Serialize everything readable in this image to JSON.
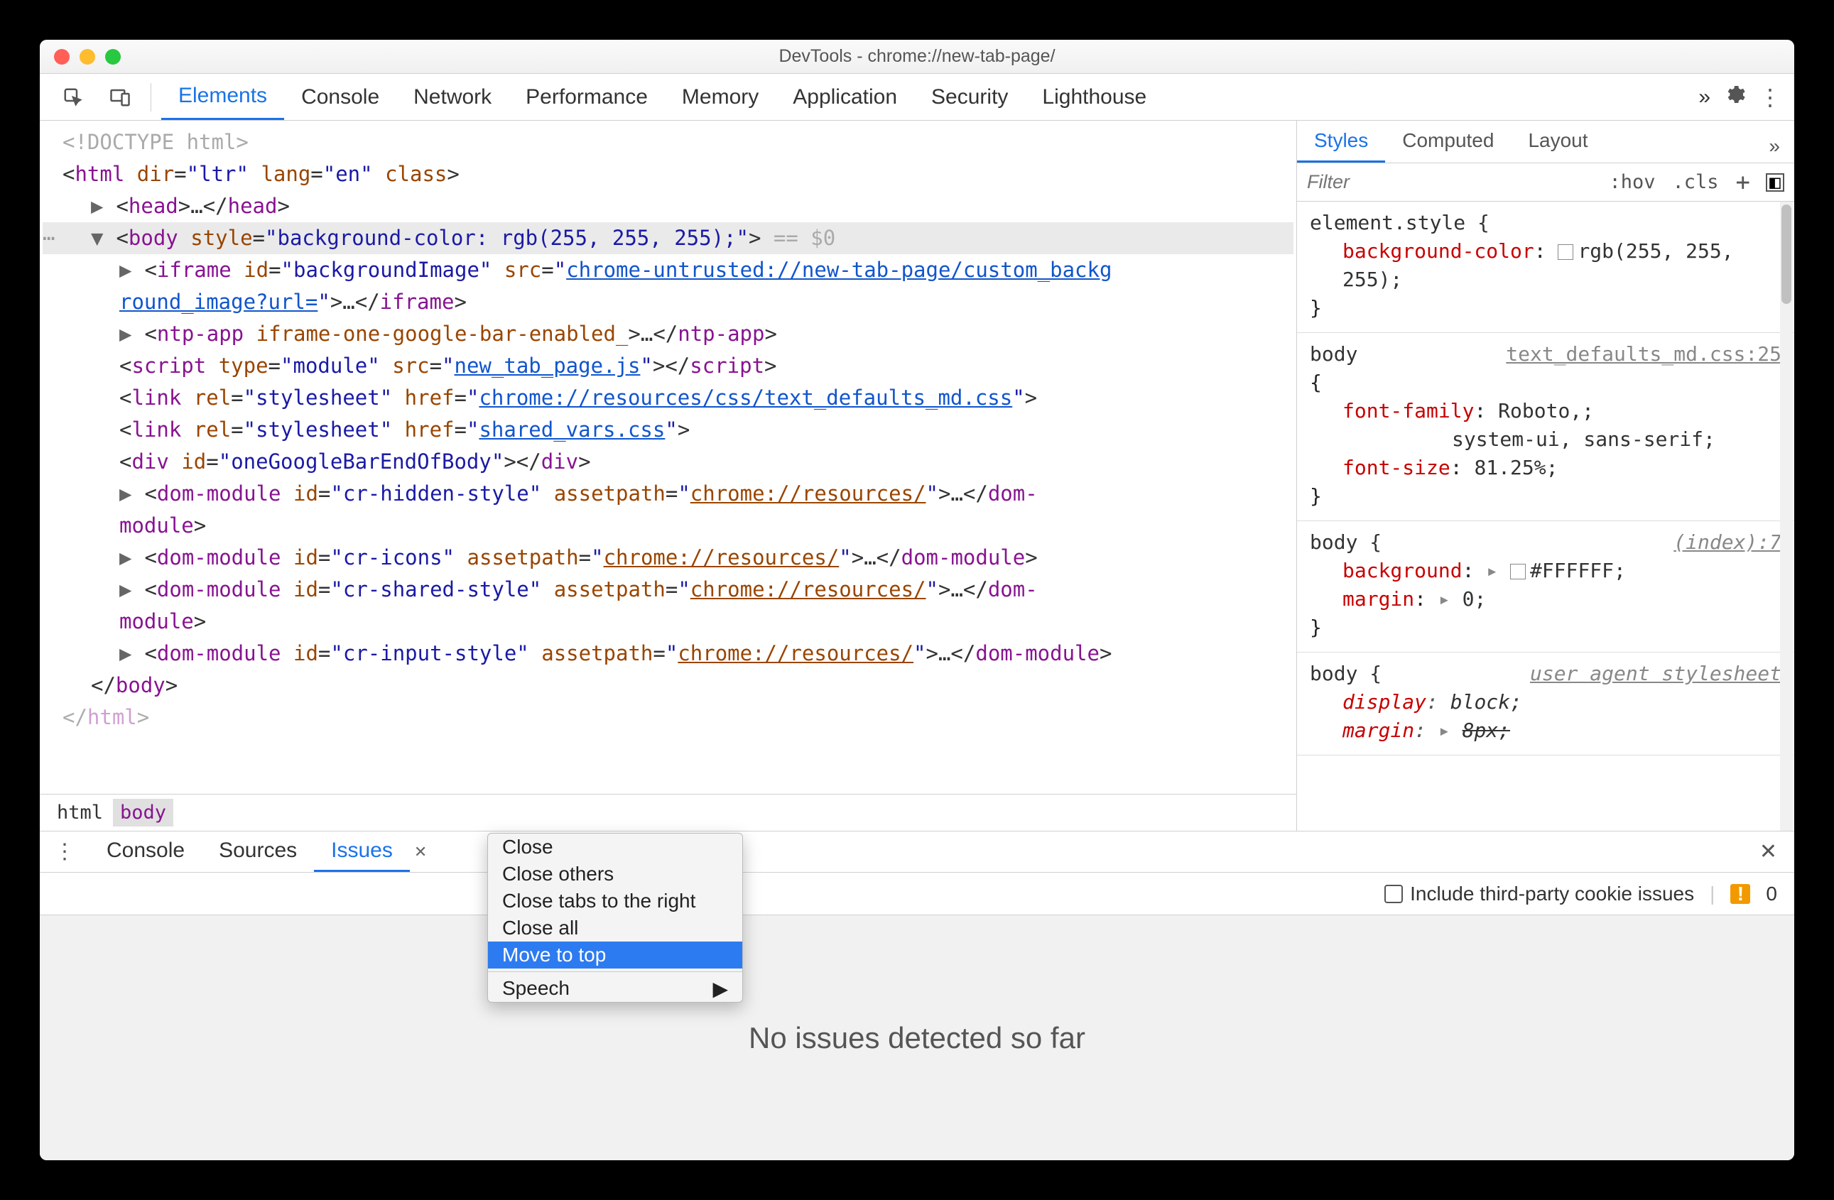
{
  "window": {
    "title": "DevTools - chrome://new-tab-page/"
  },
  "toolbar": {
    "tabs": [
      "Elements",
      "Console",
      "Network",
      "Performance",
      "Memory",
      "Application",
      "Security",
      "Lighthouse"
    ],
    "active": 0,
    "more_glyph": "»"
  },
  "dom": {
    "lines": [
      {
        "indent": 0,
        "html": "<span class='t-gray'>&lt;!DOCTYPE html&gt;</span>"
      },
      {
        "indent": 0,
        "html": "&lt;<span class='t-tag'>html</span> <span class='t-attr'>dir</span>=<span class='t-eq'>\"</span><span class='t-val'>ltr</span><span class='t-eq'>\"</span> <span class='t-attr'>lang</span>=<span class='t-eq'>\"</span><span class='t-val'>en</span><span class='t-eq'>\"</span> <span class='t-attr'>class</span>&gt;"
      },
      {
        "indent": 1,
        "arrow": "▶",
        "html": "&lt;<span class='t-tag'>head</span>&gt;…&lt;/<span class='t-tag'>head</span>&gt;"
      },
      {
        "indent": 1,
        "arrow": "▼",
        "sel": true,
        "dots": "⋯",
        "html": "&lt;<span class='t-tag'>body</span> <span class='t-attr'>style</span>=<span class='t-eq'>\"</span><span class='t-val'>background-color: rgb(255, 255, 255);</span><span class='t-eq'>\"</span>&gt;<span class='t-gray'> == $0</span>"
      },
      {
        "indent": 2,
        "arrow": "▶",
        "html": "&lt;<span class='t-tag'>iframe</span> <span class='t-attr'>id</span>=<span class='t-eq'>\"</span><span class='t-val'>backgroundImage</span><span class='t-eq'>\"</span> <span class='t-attr'>src</span>=<span class='t-eq'>\"</span><span class='t-link'>chrome-untrusted://new-tab-page/custom_backg</span>"
      },
      {
        "indent": 2,
        "cont": true,
        "html": "<span class='t-link'>round_image?url=</span><span class='t-eq'>\"</span>&gt;…&lt;/<span class='t-tag'>iframe</span>&gt;"
      },
      {
        "indent": 2,
        "arrow": "▶",
        "html": "&lt;<span class='t-tag'>ntp-app</span> <span class='t-attr'>iframe-one-google-bar-enabled_</span>&gt;…&lt;/<span class='t-tag'>ntp-app</span>&gt;"
      },
      {
        "indent": 2,
        "html": "&lt;<span class='t-tag'>script</span> <span class='t-attr'>type</span>=<span class='t-eq'>\"</span><span class='t-val'>module</span><span class='t-eq'>\"</span> <span class='t-attr'>src</span>=<span class='t-eq'>\"</span><span class='t-link'>new_tab_page.js</span><span class='t-eq'>\"</span>&gt;&lt;/<span class='t-tag'>script</span>&gt;"
      },
      {
        "indent": 2,
        "html": "&lt;<span class='t-tag'>link</span> <span class='t-attr'>rel</span>=<span class='t-eq'>\"</span><span class='t-val'>stylesheet</span><span class='t-eq'>\"</span> <span class='t-attr'>href</span>=<span class='t-eq'>\"</span><span class='t-link'>chrome://resources/css/text_defaults_md.css</span><span class='t-eq'>\"</span>&gt;"
      },
      {
        "indent": 2,
        "html": "&lt;<span class='t-tag'>link</span> <span class='t-attr'>rel</span>=<span class='t-eq'>\"</span><span class='t-val'>stylesheet</span><span class='t-eq'>\"</span> <span class='t-attr'>href</span>=<span class='t-eq'>\"</span><span class='t-link'>shared_vars.css</span><span class='t-eq'>\"</span>&gt;"
      },
      {
        "indent": 2,
        "html": "&lt;<span class='t-tag'>div</span> <span class='t-attr'>id</span>=<span class='t-eq'>\"</span><span class='t-val'>oneGoogleBarEndOfBody</span><span class='t-eq'>\"</span>&gt;&lt;/<span class='t-tag'>div</span>&gt;"
      },
      {
        "indent": 2,
        "arrow": "▶",
        "html": "&lt;<span class='t-tag'>dom-module</span> <span class='t-attr'>id</span>=<span class='t-eq'>\"</span><span class='t-val'>cr-hidden-style</span><span class='t-eq'>\"</span> <span class='t-attr'>assetpath</span>=<span class='t-eq'>\"</span><span class='t-url-attr'>chrome://resources/</span><span class='t-eq'>\"</span>&gt;…&lt;/<span class='t-tag'>dom-</span>"
      },
      {
        "indent": 2,
        "cont": true,
        "html": "<span class='t-tag'>module</span>&gt;"
      },
      {
        "indent": 2,
        "arrow": "▶",
        "html": "&lt;<span class='t-tag'>dom-module</span> <span class='t-attr'>id</span>=<span class='t-eq'>\"</span><span class='t-val'>cr-icons</span><span class='t-eq'>\"</span> <span class='t-attr'>assetpath</span>=<span class='t-eq'>\"</span><span class='t-url-attr'>chrome://resources/</span><span class='t-eq'>\"</span>&gt;…&lt;/<span class='t-tag'>dom-module</span>&gt;"
      },
      {
        "indent": 2,
        "arrow": "▶",
        "html": "&lt;<span class='t-tag'>dom-module</span> <span class='t-attr'>id</span>=<span class='t-eq'>\"</span><span class='t-val'>cr-shared-style</span><span class='t-eq'>\"</span> <span class='t-attr'>assetpath</span>=<span class='t-eq'>\"</span><span class='t-url-attr'>chrome://resources/</span><span class='t-eq'>\"</span>&gt;…&lt;/<span class='t-tag'>dom-</span>"
      },
      {
        "indent": 2,
        "cont": true,
        "html": "<span class='t-tag'>module</span>&gt;"
      },
      {
        "indent": 2,
        "arrow": "▶",
        "html": "&lt;<span class='t-tag'>dom-module</span> <span class='t-attr'>id</span>=<span class='t-eq'>\"</span><span class='t-val'>cr-input-style</span><span class='t-eq'>\"</span> <span class='t-attr'>assetpath</span>=<span class='t-eq'>\"</span><span class='t-url-attr'>chrome://resources/</span><span class='t-eq'>\"</span>&gt;…&lt;/<span class='t-tag'>dom-module</span>&gt;"
      },
      {
        "indent": 1,
        "html": "&lt;/<span class='t-tag'>body</span>&gt;"
      },
      {
        "indent": 0,
        "html": "&lt;/<span class='t-tag'>html</span>&gt;",
        "faded": true
      }
    ]
  },
  "breadcrumb": [
    "html",
    "body"
  ],
  "styles": {
    "tabs": [
      "Styles",
      "Computed",
      "Layout"
    ],
    "active": 0,
    "filter_placeholder": "Filter",
    "chips": [
      ":hov",
      ".cls"
    ],
    "rules": [
      {
        "selector": "element.style {",
        "src": "",
        "decls": [
          {
            "prop": "background-color",
            "val": "rgb(255, 255, 255)",
            "swatch": "#ffffff"
          }
        ],
        "close": "}"
      },
      {
        "selector": "body",
        "brace_newline": true,
        "src": "text_defaults_md.css:25",
        "decls": [
          {
            "prop": "font-family",
            "val": "Roboto,",
            "val2": "system-ui, sans-serif"
          },
          {
            "prop": "font-size",
            "val": "81.25%"
          }
        ],
        "close": "}"
      },
      {
        "selector": "body {",
        "src": "(index):7",
        "src_italic": true,
        "decls": [
          {
            "prop": "background",
            "tri": true,
            "val": "#FFFFFF",
            "swatch": "#ffffff"
          },
          {
            "prop": "margin",
            "tri": true,
            "val": "0"
          }
        ],
        "close": "}"
      },
      {
        "selector": "body {",
        "src": "user agent stylesheet",
        "src_italic": true,
        "ua": true,
        "decls": [
          {
            "prop": "display",
            "val": "block",
            "italic": true
          },
          {
            "prop": "margin",
            "tri": true,
            "val": "8px",
            "strike": true,
            "italic": true
          }
        ],
        "close": ""
      }
    ]
  },
  "drawer": {
    "tabs": [
      "Console",
      "Sources",
      "Issues"
    ],
    "active": 2,
    "checkbox_label": "Include third-party cookie issues",
    "issue_count": "0",
    "empty_text": "No issues detected so far"
  },
  "context_menu": {
    "items": [
      {
        "label": "Close"
      },
      {
        "label": "Close others"
      },
      {
        "label": "Close tabs to the right"
      },
      {
        "label": "Close all"
      },
      {
        "label": "Move to top",
        "highlighted": true
      },
      {
        "sep": true
      },
      {
        "label": "Speech",
        "submenu": true
      }
    ]
  }
}
